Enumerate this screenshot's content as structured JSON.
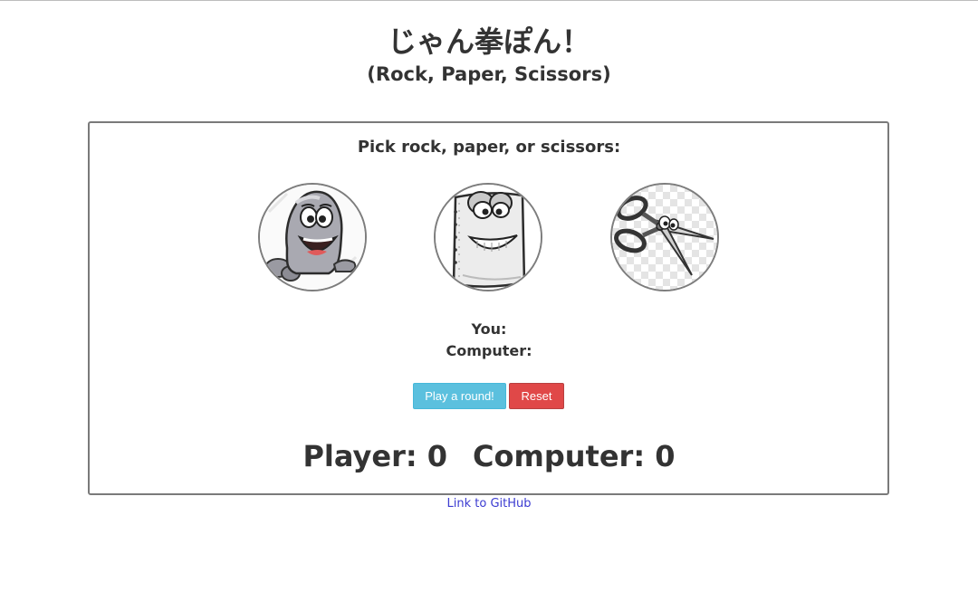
{
  "header": {
    "title": "じゃん拳ぽん！",
    "subtitle": "(Rock, Paper, Scissors)"
  },
  "game": {
    "prompt": "Pick rock, paper, or scissors:",
    "choices": [
      {
        "name": "rock",
        "icon": "rock-character-icon"
      },
      {
        "name": "paper",
        "icon": "paper-character-icon"
      },
      {
        "name": "scissors",
        "icon": "scissors-character-icon"
      }
    ],
    "result": {
      "you_label": "You:",
      "computer_label": "Computer:"
    },
    "buttons": {
      "play_label": "Play a round!",
      "reset_label": "Reset"
    },
    "score": {
      "player_label": "Player:",
      "player_value": "0",
      "computer_label": "Computer:",
      "computer_value": "0"
    }
  },
  "footer": {
    "github_link": "Link to GitHub"
  },
  "colors": {
    "play_button": "#5bc0de",
    "reset_button": "#e04848",
    "link": "#3b3bd1",
    "text": "#333333"
  }
}
